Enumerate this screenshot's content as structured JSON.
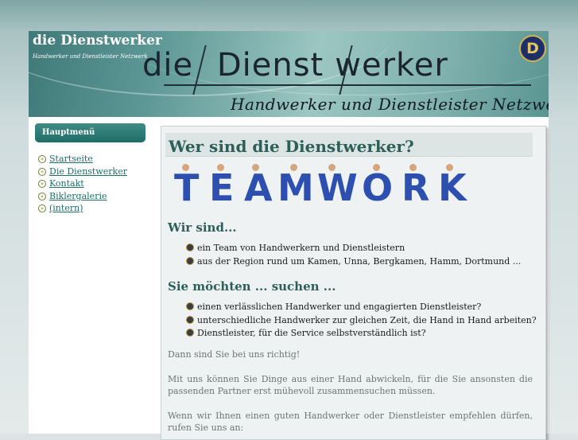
{
  "header": {
    "site_title": "die Dienstwerker",
    "tagline": "Handwerker und Dienstleister Netzwerk",
    "logo_word_left": "die",
    "logo_word_mid": "Dienst",
    "logo_word_right": "werker",
    "logo_subtitle": "Handwerker und Dienstleister Netzwerk",
    "badge_letter": "D"
  },
  "sidebar": {
    "title": "Hauptmenü",
    "items": [
      {
        "label": "Startseite"
      },
      {
        "label": "Die Dienstwerker"
      },
      {
        "label": "Kontakt"
      },
      {
        "label": "Biklergalerie"
      },
      {
        "label": "(intern)"
      }
    ]
  },
  "main": {
    "title": "Wer sind die Dienstwerker?",
    "teamwork_letters": [
      "T",
      "E",
      "A",
      "M",
      "W",
      "O",
      "R",
      "K"
    ],
    "section1_heading": "Wir sind...",
    "section1_items": [
      "ein Team von Handwerkern und Dienstleistern",
      "aus der Region rund um Kamen, Unna, Bergkamen, Hamm, Dortmund ..."
    ],
    "section2_heading": "Sie möchten ... suchen ...",
    "section2_items": [
      "einen verlässlichen Handwerker und engagierten Dienstleister?",
      "unterschiedliche Handwerker zur gleichen Zeit, die Hand in Hand arbeiten?",
      "Dienstleister, für die Service selbstverständlich ist?"
    ],
    "para1": "Dann sind Sie bei uns richtig!",
    "para2": "Mit uns können Sie Dinge aus einer Hand abwickeln, für die Sie ansonsten die passenden Partner erst mühevoll zusammensuchen müssen.",
    "para3": "Wenn wir Ihnen einen guten Handwerker oder Dienstleister empfehlen dürfen, rufen Sie uns an:"
  },
  "colors": {
    "accent": "#2d5f5a",
    "link": "#1d6f68",
    "menu_header": "#1f6d68"
  }
}
